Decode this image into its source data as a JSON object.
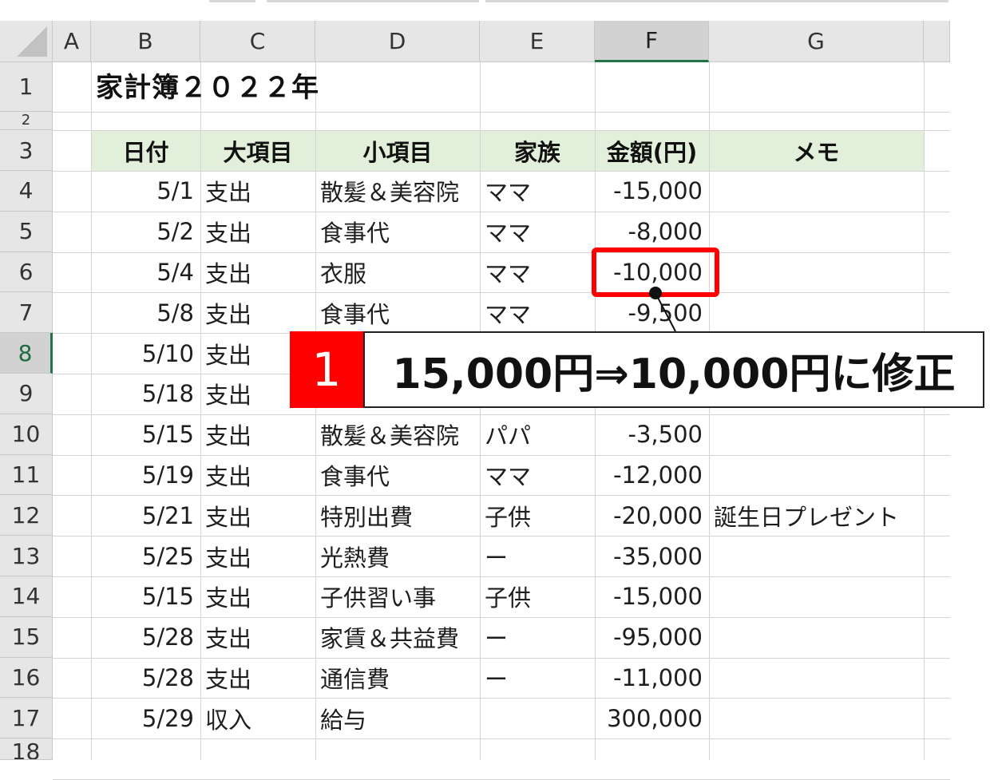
{
  "columns": [
    "A",
    "B",
    "C",
    "D",
    "E",
    "F",
    "G"
  ],
  "rows": [
    "1",
    "2",
    "3",
    "4",
    "5",
    "6",
    "7",
    "8",
    "9",
    "10",
    "11",
    "12",
    "13",
    "14",
    "15",
    "16",
    "17",
    "18"
  ],
  "title": "家計簿２０２２年",
  "headers": {
    "date": "日付",
    "category": "大項目",
    "subcategory": "小項目",
    "family": "家族",
    "amount": "金額(円)",
    "memo": "メモ"
  },
  "records": [
    {
      "row": "4",
      "date": "5/1",
      "category": "支出",
      "subcategory": "散髪＆美容院",
      "family": "ママ",
      "amount": "-15,000",
      "memo": ""
    },
    {
      "row": "5",
      "date": "5/2",
      "category": "支出",
      "subcategory": "食事代",
      "family": "ママ",
      "amount": "-8,000",
      "memo": ""
    },
    {
      "row": "6",
      "date": "5/4",
      "category": "支出",
      "subcategory": "衣服",
      "family": "ママ",
      "amount": "-10,000",
      "memo": ""
    },
    {
      "row": "7",
      "date": "5/8",
      "category": "支出",
      "subcategory": "食事代",
      "family": "ママ",
      "amount": "-9,500",
      "memo": ""
    },
    {
      "row": "8",
      "date": "5/10",
      "category": "支出",
      "subcategory": "",
      "family": "",
      "amount": "",
      "memo": ""
    },
    {
      "row": "9",
      "date": "5/18",
      "category": "支出",
      "subcategory": "",
      "family": "",
      "amount": "",
      "memo": ""
    },
    {
      "row": "10",
      "date": "5/15",
      "category": "支出",
      "subcategory": "散髪＆美容院",
      "family": "パパ",
      "amount": "-3,500",
      "memo": ""
    },
    {
      "row": "11",
      "date": "5/19",
      "category": "支出",
      "subcategory": "食事代",
      "family": "ママ",
      "amount": "-12,000",
      "memo": ""
    },
    {
      "row": "12",
      "date": "5/21",
      "category": "支出",
      "subcategory": "特別出費",
      "family": "子供",
      "amount": "-20,000",
      "memo": "誕生日プレゼント"
    },
    {
      "row": "13",
      "date": "5/25",
      "category": "支出",
      "subcategory": "光熱費",
      "family": "ー",
      "amount": "-35,000",
      "memo": ""
    },
    {
      "row": "14",
      "date": "5/15",
      "category": "支出",
      "subcategory": "子供習い事",
      "family": "子供",
      "amount": "-15,000",
      "memo": ""
    },
    {
      "row": "15",
      "date": "5/28",
      "category": "支出",
      "subcategory": "家賃＆共益費",
      "family": "ー",
      "amount": "-95,000",
      "memo": ""
    },
    {
      "row": "16",
      "date": "5/28",
      "category": "支出",
      "subcategory": "通信費",
      "family": "ー",
      "amount": "-11,000",
      "memo": ""
    },
    {
      "row": "17",
      "date": "5/29",
      "category": "収入",
      "subcategory": "給与",
      "family": "",
      "amount": "300,000",
      "memo": ""
    }
  ],
  "callout": {
    "number": "1",
    "text": "15,000円⇒10,000円に修正"
  },
  "selection": {
    "column": "F",
    "row": "8"
  },
  "colors": {
    "header_band": "#e2efda",
    "highlight": "#ff0000",
    "selection_accent": "#217346",
    "grid": "#d4d4d4"
  }
}
